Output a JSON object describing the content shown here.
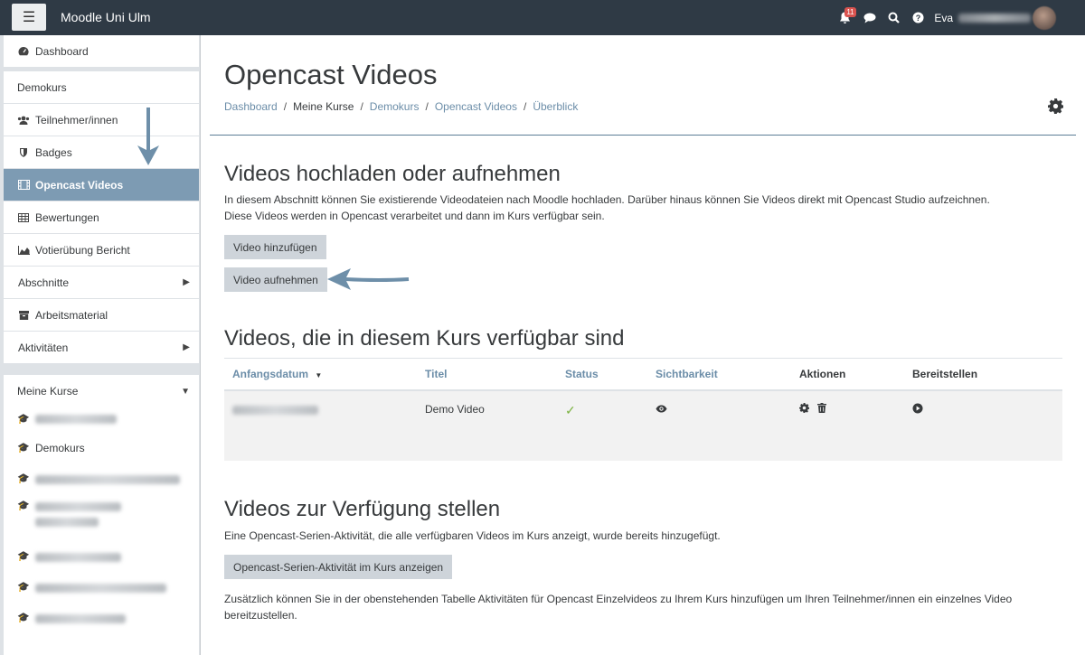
{
  "navbar": {
    "menu_icon": "hamburger-icon",
    "brand": "Moodle Uni Ulm",
    "notification_count": "11",
    "user_name": "Eva"
  },
  "sidebar": {
    "dashboard": "Dashboard",
    "course_heading": "Demokurs",
    "items": [
      {
        "label": "Teilnehmer/innen",
        "icon": "users-icon"
      },
      {
        "label": "Badges",
        "icon": "shield-icon"
      },
      {
        "label": "Opencast Videos",
        "icon": "film-icon"
      },
      {
        "label": "Bewertungen",
        "icon": "table-icon"
      },
      {
        "label": "Votierübung Bericht",
        "icon": "chart-icon"
      },
      {
        "label": "Abschnitte",
        "icon": ""
      },
      {
        "label": "Arbeitsmaterial",
        "icon": "archive-icon"
      },
      {
        "label": "Aktivitäten",
        "icon": ""
      }
    ],
    "my_courses": "Meine Kurse",
    "courses": [
      {
        "label": ""
      },
      {
        "label": "Demokurs"
      },
      {
        "label": ""
      },
      {
        "label": ""
      },
      {
        "label": ""
      },
      {
        "label": ""
      },
      {
        "label": ""
      }
    ]
  },
  "main": {
    "title": "Opencast Videos",
    "breadcrumb": [
      "Dashboard",
      "Meine Kurse",
      "Demokurs",
      "Opencast Videos",
      "Überblick"
    ],
    "upload_section": {
      "heading": "Videos hochladen oder aufnehmen",
      "line1": "In diesem Abschnitt können Sie existierende Videodateien nach Moodle hochladen. Darüber hinaus können Sie Videos direkt mit Opencast Studio aufzeichnen.",
      "line2": "Diese Videos werden in Opencast verarbeitet und dann im Kurs verfügbar sein.",
      "add_button": "Video hinzufügen",
      "record_button": "Video aufnehmen"
    },
    "videos_section": {
      "heading": "Videos, die in diesem Kurs verfügbar sind",
      "columns": [
        "Anfangsdatum",
        "Titel",
        "Status",
        "Sichtbarkeit",
        "Aktionen",
        "Bereitstellen"
      ],
      "rows": [
        {
          "title": "Demo Video"
        }
      ]
    },
    "provide_section": {
      "heading": "Videos zur Verfügung stellen",
      "text1": "Eine Opencast-Serien-Aktivität, die alle verfügbaren Videos im Kurs anzeigt, wurde bereits hinzugefügt.",
      "button": "Opencast-Serien-Aktivität im Kurs anzeigen",
      "text2": "Zusätzlich können Sie in der obenstehenden Tabelle Aktivitäten für Opencast Einzelvideos zu Ihrem Kurs hinzufügen um Ihren Teilnehmer/innen ein einzelnes Video bereitzustellen."
    }
  },
  "colors": {
    "navbar": "#2f3a45",
    "active": "#7d9bb3",
    "link": "#6b8da8",
    "button": "#ced4da"
  }
}
